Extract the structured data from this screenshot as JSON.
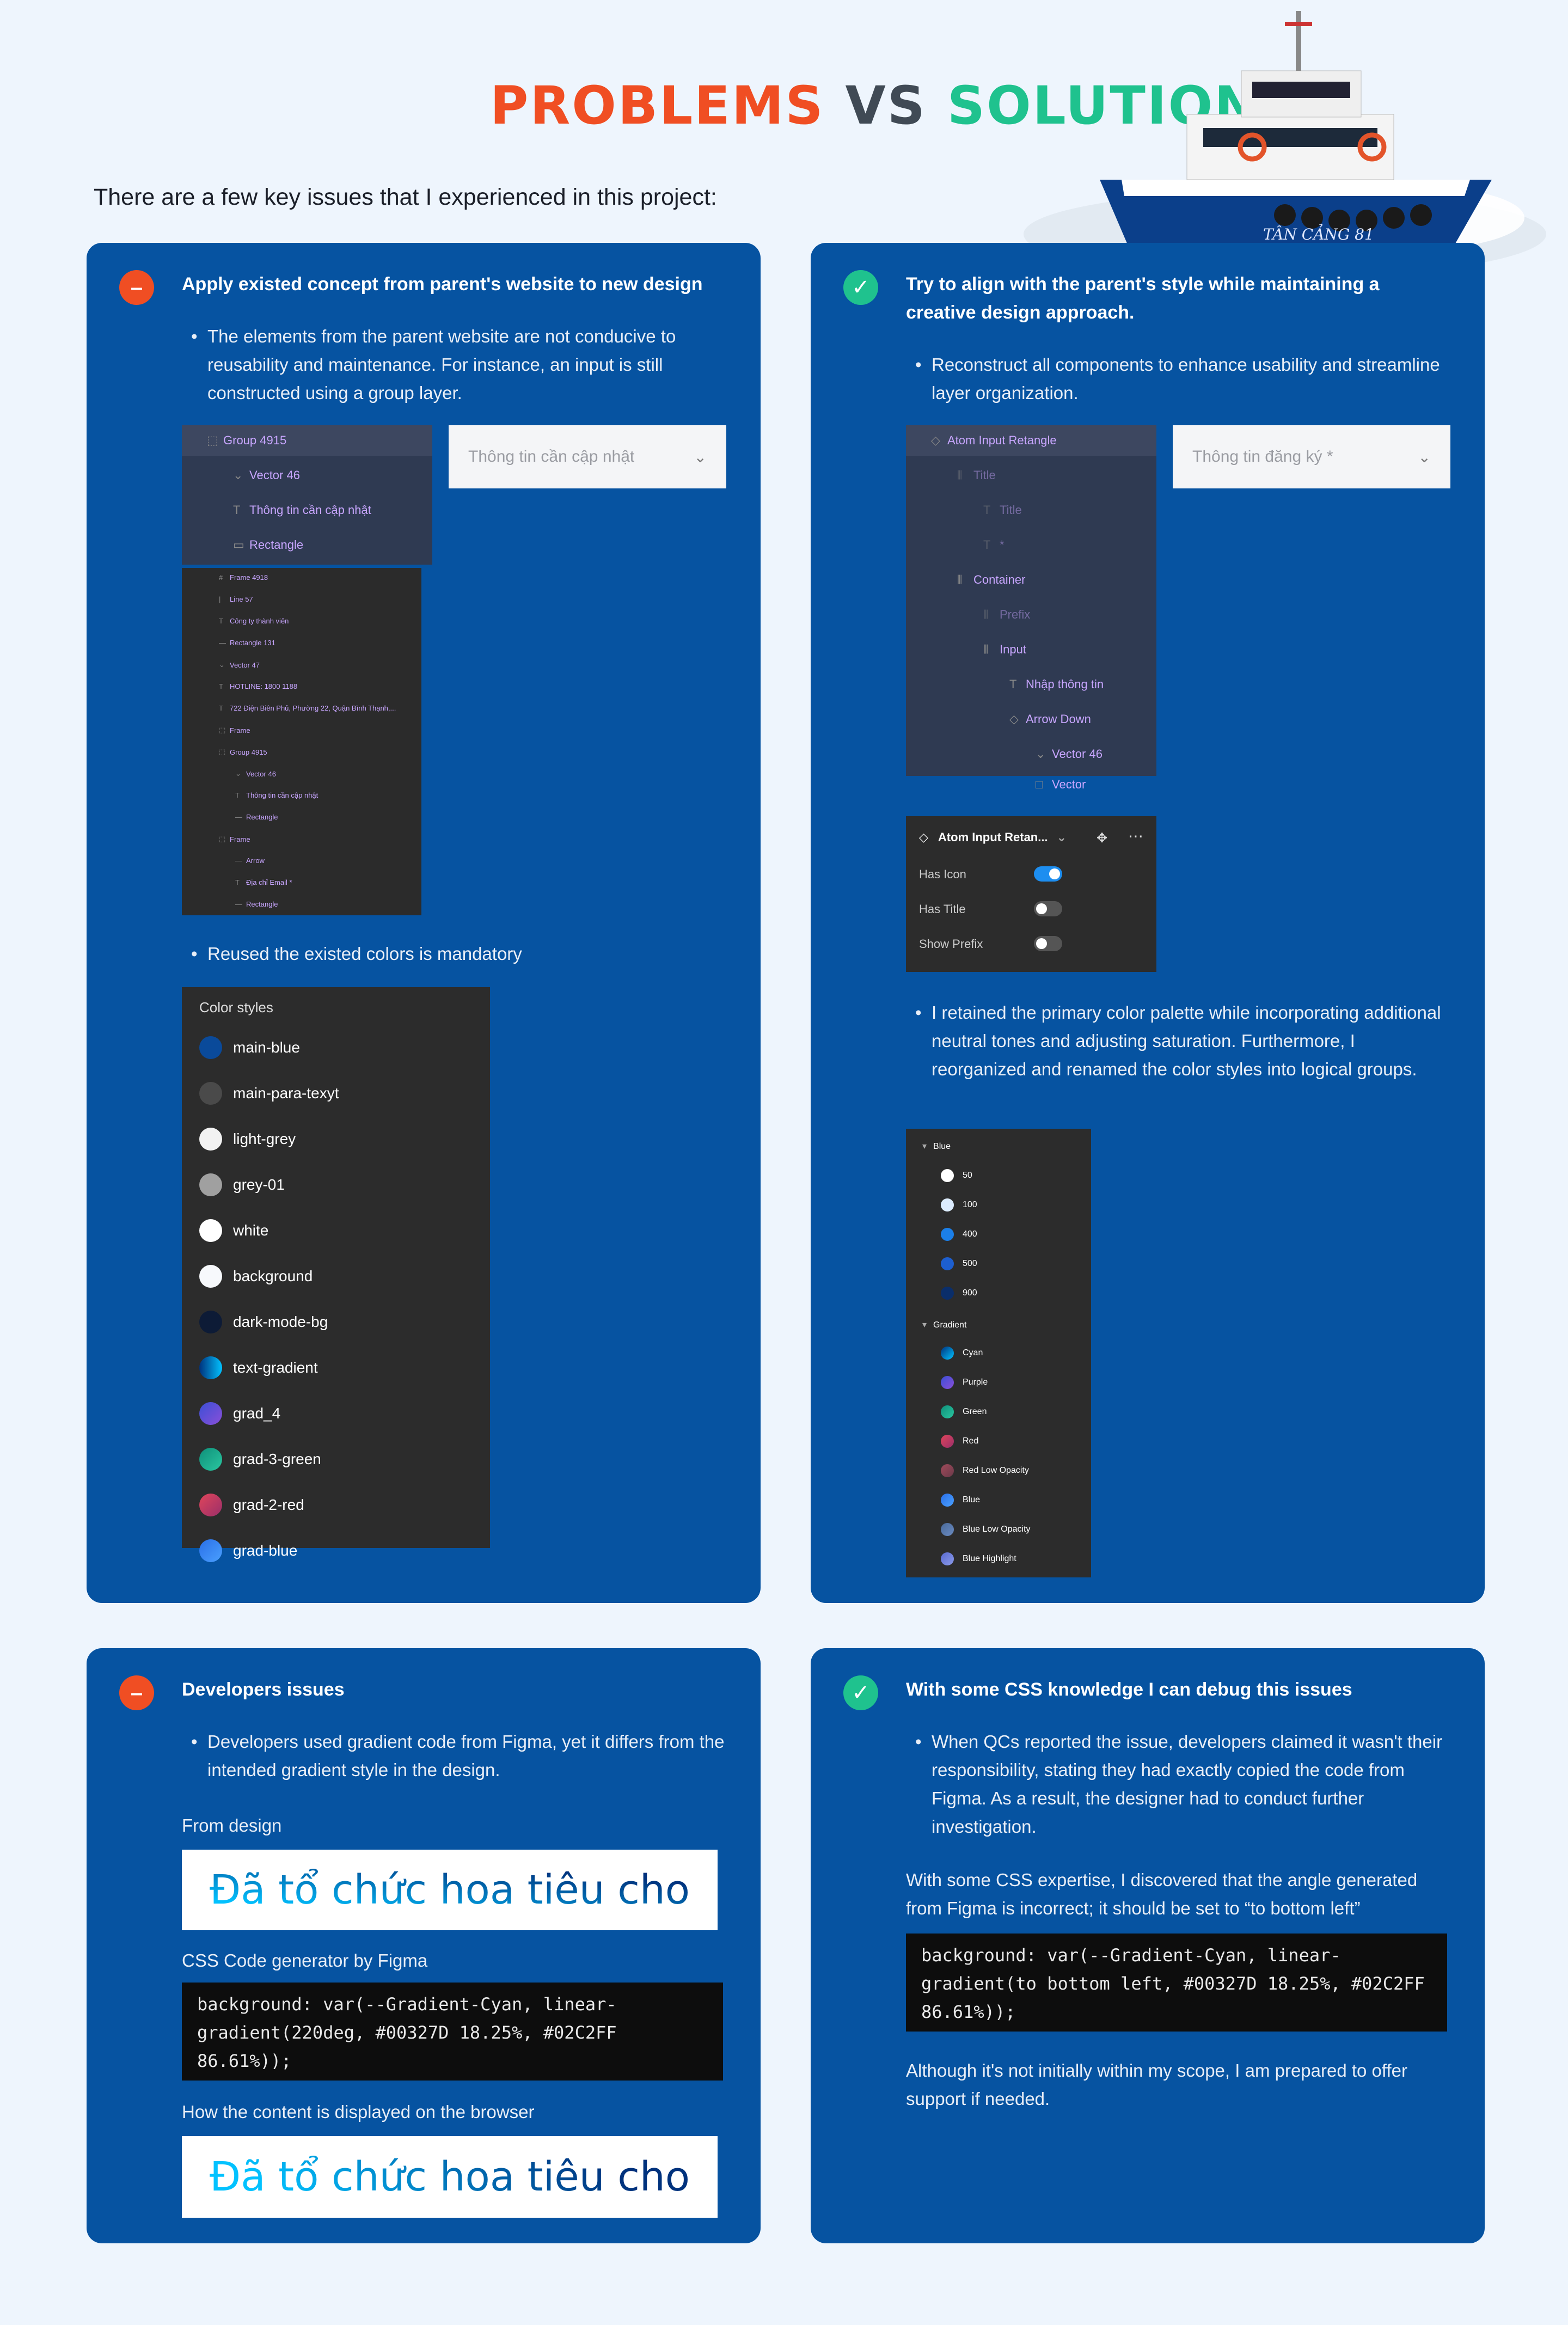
{
  "header": {
    "problems": "PROBLEMS",
    "vs": "VS",
    "solutions": "SOLUTIONS",
    "intro": "There are a few key issues that I experienced in this project:",
    "boat_name": "TÂN CẢNG 81"
  },
  "colors": {
    "accent_red": "#f04e23",
    "accent_green": "#1fc28e",
    "card_blue": "#0653a1"
  },
  "problem1": {
    "title": "Apply existed concept from parent's website to new design",
    "bullet1": "The elements from the parent website are not conducive to reusability and maintenance. For instance, an input is still constructed using a group layer.",
    "layers": [
      {
        "label": "Group 4915",
        "icon": "grid-icon"
      },
      {
        "label": "Vector 46",
        "icon": "chevron-icon"
      },
      {
        "label": "Thông tin cần cập nhật",
        "icon": "text-icon"
      },
      {
        "label": "Rectangle",
        "icon": "rectangle-icon"
      }
    ],
    "input_placeholder": "Thông tin cần cập nhật",
    "tiny_layers": [
      "Frame 4918",
      "Line 57",
      "Công ty thành viên",
      "Rectangle 131",
      "Vector 47",
      "HOTLINE: 1800 1188",
      "722 Điện Biên Phủ, Phường 22, Quận Bình Thạnh,...",
      "Frame",
      "Group 4915",
      "Vector 46",
      "Thông tin cần cập nhật",
      "Rectangle",
      "Frame",
      "Arrow",
      "Địa chỉ Email *",
      "Rectangle"
    ],
    "bullet2": "Reused the existed colors is mandatory",
    "color_styles_title": "Color styles",
    "color_styles": [
      {
        "name": "main-blue",
        "color": "#0a4a9a"
      },
      {
        "name": "main-para-texyt",
        "color": "#4a4a4a"
      },
      {
        "name": "light-grey",
        "color": "#f2f2f2"
      },
      {
        "name": "grey-01",
        "color": "#a0a0a0"
      },
      {
        "name": "white",
        "color": "#ffffff"
      },
      {
        "name": "background",
        "color": "#f7f9fc"
      },
      {
        "name": "dark-mode-bg",
        "color": "#0d1b36"
      },
      {
        "name": "text-gradient",
        "color": "linear-gradient(90deg,#00327D,#02C2FF)"
      },
      {
        "name": "grad_4",
        "color": "linear-gradient(135deg,#3b4fd6,#8a4fd8)"
      },
      {
        "name": "grad-3-green",
        "color": "linear-gradient(135deg,#0f8f7a,#2ac7a0)"
      },
      {
        "name": "grad-2-red",
        "color": "linear-gradient(135deg,#e0455a,#9a2f6a)"
      },
      {
        "name": "grad-blue",
        "color": "linear-gradient(135deg,#2a6fe8,#4aa0ff)"
      }
    ]
  },
  "solution1": {
    "title": "Try to align with the parent's style while maintaining a creative design approach.",
    "bullet1": "Reconstruct all components to enhance usability and streamline layer organization.",
    "layers": [
      {
        "label": "Atom Input Retangle",
        "icon": "component-icon",
        "indent": 0,
        "dim": false
      },
      {
        "label": "Title",
        "icon": "autolayout-icon",
        "indent": 1,
        "dim": true
      },
      {
        "label": "Title",
        "icon": "text-icon",
        "indent": 2,
        "dim": true
      },
      {
        "label": "*",
        "icon": "text-icon",
        "indent": 2,
        "dim": true
      },
      {
        "label": "Container",
        "icon": "autolayout-icon",
        "indent": 1,
        "dim": false
      },
      {
        "label": "Prefix",
        "icon": "autolayout-icon",
        "indent": 2,
        "dim": true
      },
      {
        "label": "Input",
        "icon": "autolayout-icon",
        "indent": 2,
        "dim": false
      },
      {
        "label": "Nhập thông tin",
        "icon": "text-icon",
        "indent": 3,
        "dim": false
      },
      {
        "label": "Arrow Down",
        "icon": "instance-icon",
        "indent": 3,
        "dim": false
      },
      {
        "label": "Vector 46",
        "icon": "chevron-icon",
        "indent": 4,
        "dim": false
      },
      {
        "label": "Vector",
        "icon": "square-icon",
        "indent": 4,
        "dim": false
      }
    ],
    "input_placeholder": "Thông tin đăng ký *",
    "props_title": "Atom Input Retan...",
    "props": [
      {
        "label": "Has Icon",
        "on": true
      },
      {
        "label": "Has Title",
        "on": false
      },
      {
        "label": "Show Prefix",
        "on": false
      }
    ],
    "bullet2": "I retained the primary color palette while incorporating additional neutral tones and adjusting saturation. Furthermore, I reorganized and renamed the color styles into logical groups.",
    "group_blue": "Blue",
    "blue_shades": [
      {
        "name": "50",
        "color": "#ffffff"
      },
      {
        "name": "100",
        "color": "#dcecff"
      },
      {
        "name": "400",
        "color": "#1b7fe8"
      },
      {
        "name": "500",
        "color": "#1d5fd0"
      },
      {
        "name": "900",
        "color": "#0a2e6a"
      }
    ],
    "group_gradient": "Gradient",
    "gradients": [
      {
        "name": "Cyan",
        "color": "linear-gradient(135deg,#00327D,#02C2FF)"
      },
      {
        "name": "Purple",
        "color": "linear-gradient(135deg,#3b4fd6,#8a4fd8)"
      },
      {
        "name": "Green",
        "color": "linear-gradient(135deg,#0f8f7a,#2ac7a0)"
      },
      {
        "name": "Red",
        "color": "linear-gradient(135deg,#e0455a,#9a2f6a)"
      },
      {
        "name": "Red Low Opacity",
        "color": "linear-gradient(135deg,#a04a5a,#6a3a4a)"
      },
      {
        "name": "Blue",
        "color": "linear-gradient(135deg,#2a6fe8,#4aa0ff)"
      },
      {
        "name": "Blue Low Opacity",
        "color": "linear-gradient(135deg,#4a6a9a,#6a8ac0)"
      },
      {
        "name": "Blue Highlight",
        "color": "linear-gradient(135deg,#5a6ad0,#8a9ae8)"
      }
    ]
  },
  "problem2": {
    "title": "Developers issues",
    "bullet1": "Developers used gradient code from Figma, yet it differs from the intended gradient style in the design.",
    "from_design": "From design",
    "demo_text": "Đã tổ chức hoa tiêu cho",
    "css_label": "CSS Code generator by Figma",
    "code": "background: var(--Gradient-Cyan, linear-gradient(220deg, #00327D 18.25%, #02C2FF 86.61%));",
    "browser_label": "How the content is displayed on the browser",
    "demo_text2": "Đã tổ chức hoa tiêu cho"
  },
  "solution2": {
    "title": "With some CSS knowledge I can debug this issues",
    "bullet1": "When QCs reported the issue, developers claimed it wasn't their responsibility, stating they had exactly copied the code from Figma. As a result, the designer had to conduct further investigation.",
    "para1": "With some CSS expertise, I discovered that the angle generated from Figma is incorrect; it should be set to “to bottom left”",
    "code": "background: var(--Gradient-Cyan, linear-gradient(to bottom left, #00327D 18.25%, #02C2FF 86.61%));",
    "para2": "Although it's not initially within my scope, I am prepared to offer support if needed."
  }
}
